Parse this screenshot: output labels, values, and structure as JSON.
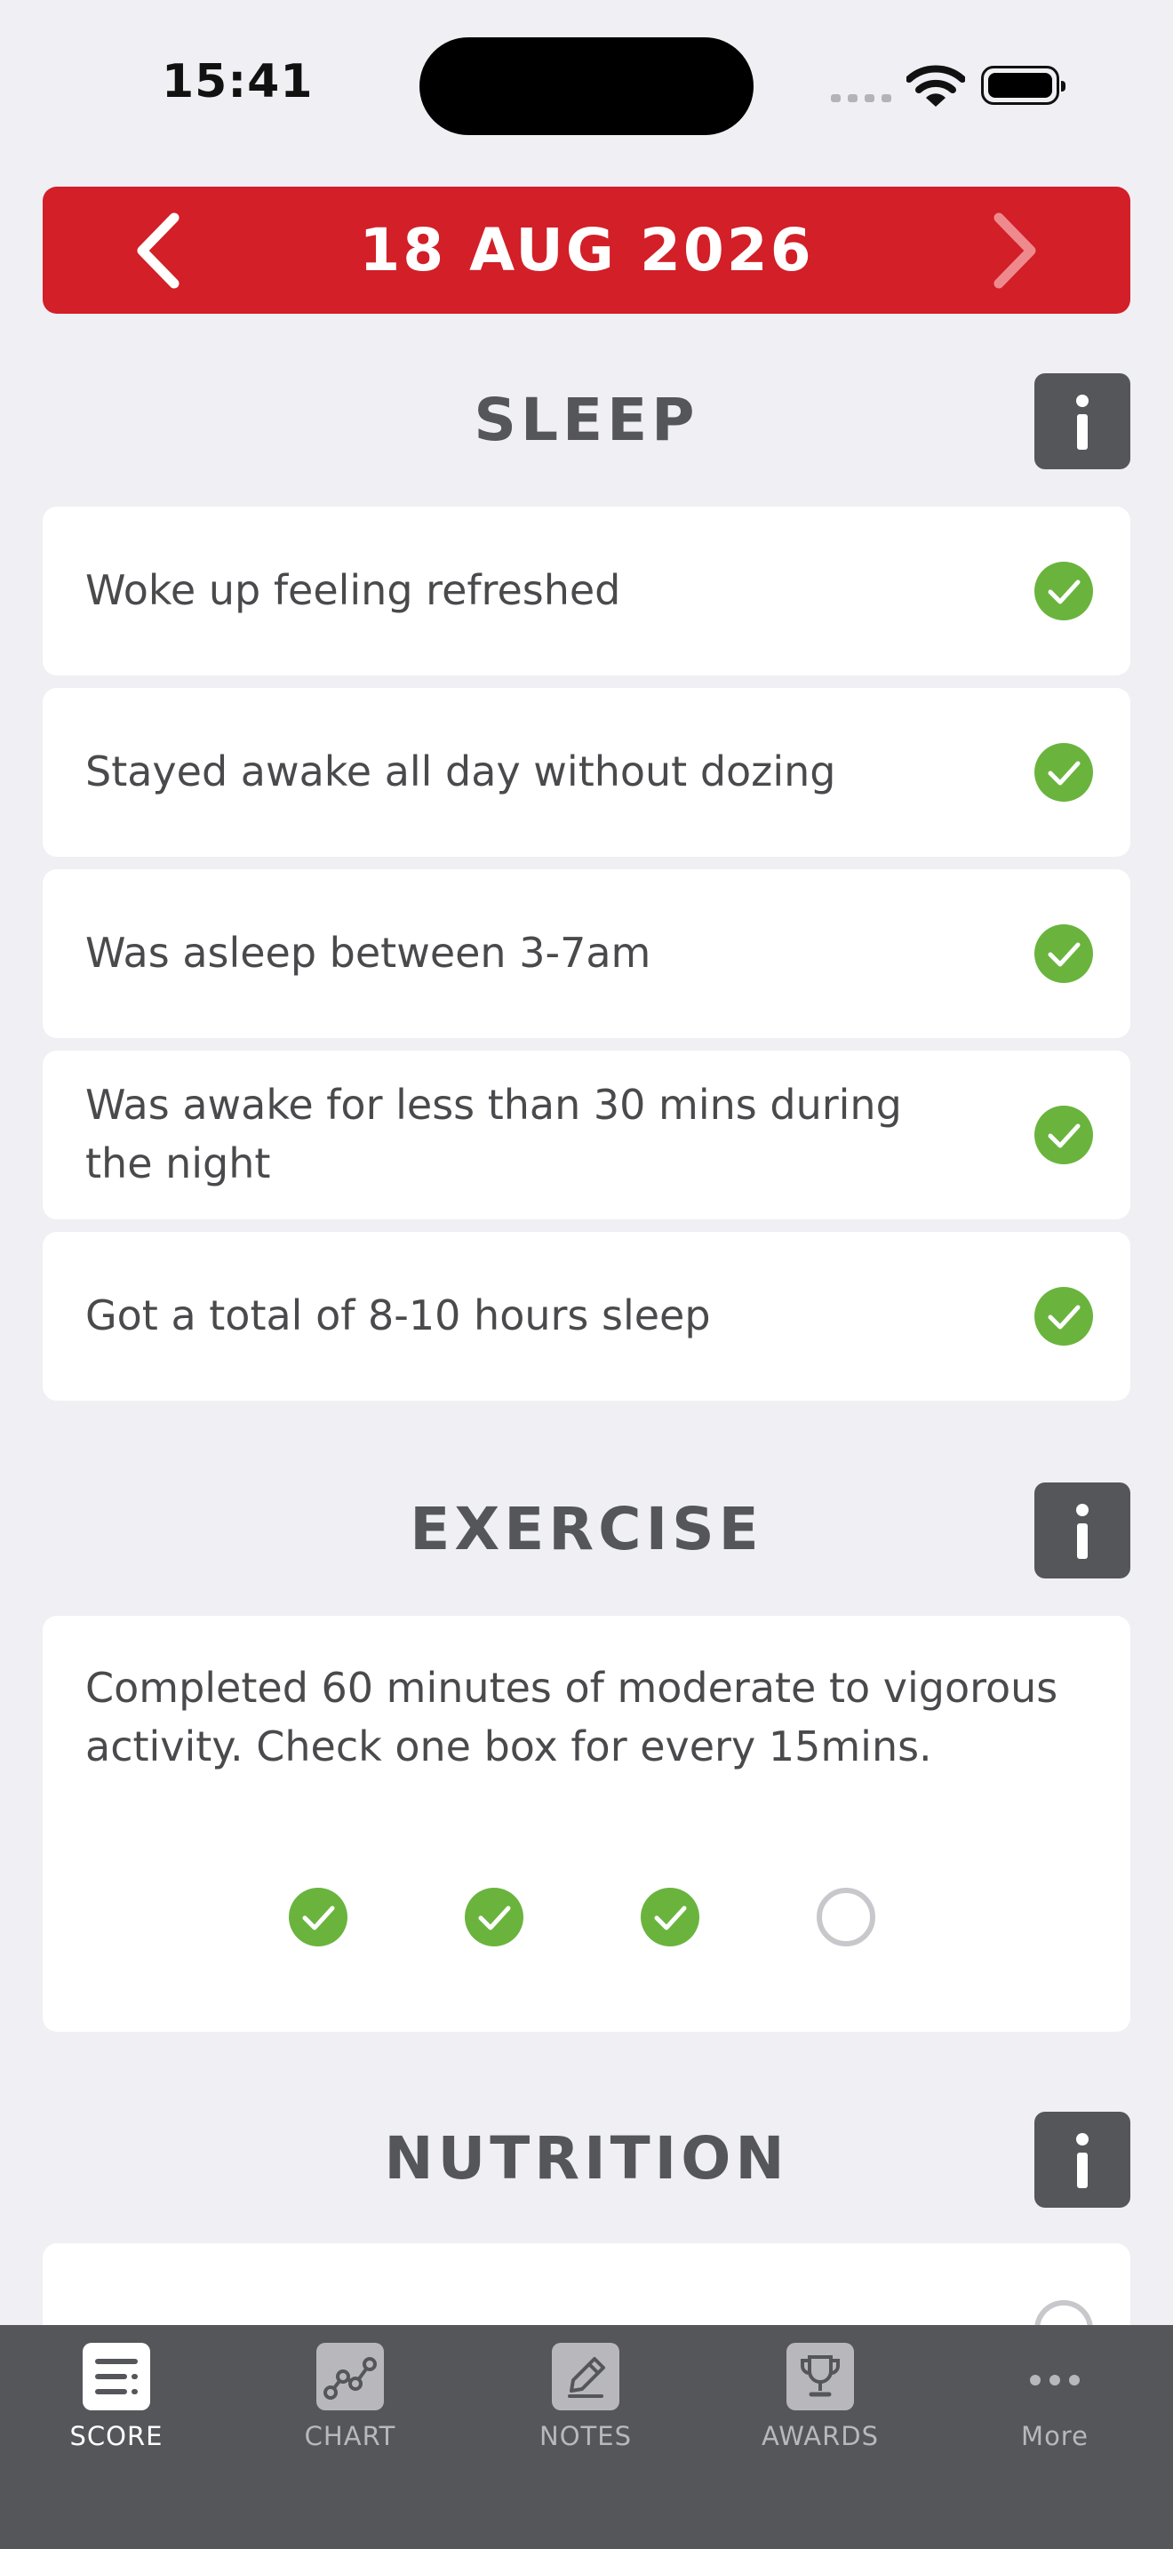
{
  "status_bar": {
    "time": "15:41"
  },
  "date_nav": {
    "date": "18 AUG 2026"
  },
  "sections": {
    "sleep": {
      "title": "SLEEP",
      "items": [
        {
          "text": "Woke up feeling refreshed",
          "checked": true
        },
        {
          "text": "Stayed awake all day without dozing",
          "checked": true
        },
        {
          "text": "Was asleep between 3-7am",
          "checked": true
        },
        {
          "text": "Was awake for less than 30 mins during the night",
          "checked": true
        },
        {
          "text": "Got a total of 8-10 hours sleep",
          "checked": true
        }
      ]
    },
    "exercise": {
      "title": "EXERCISE",
      "description": "Completed 60 minutes of moderate to vigorous activity. Check one box for every 15mins.",
      "boxes_checked": 3,
      "boxes_total": 4
    },
    "nutrition": {
      "title": "NUTRITION"
    }
  },
  "tabs": [
    {
      "label": "SCORE",
      "icon": "list-icon",
      "active": true
    },
    {
      "label": "CHART",
      "icon": "chart-icon",
      "active": false
    },
    {
      "label": "NOTES",
      "icon": "pencil-icon",
      "active": false
    },
    {
      "label": "AWARDS",
      "icon": "trophy-icon",
      "active": false
    },
    {
      "label": "More",
      "icon": "more-icon",
      "active": false
    }
  ],
  "colors": {
    "accent_red": "#d21f28",
    "check_green": "#6ab43e",
    "dark_gray": "#55565a"
  }
}
